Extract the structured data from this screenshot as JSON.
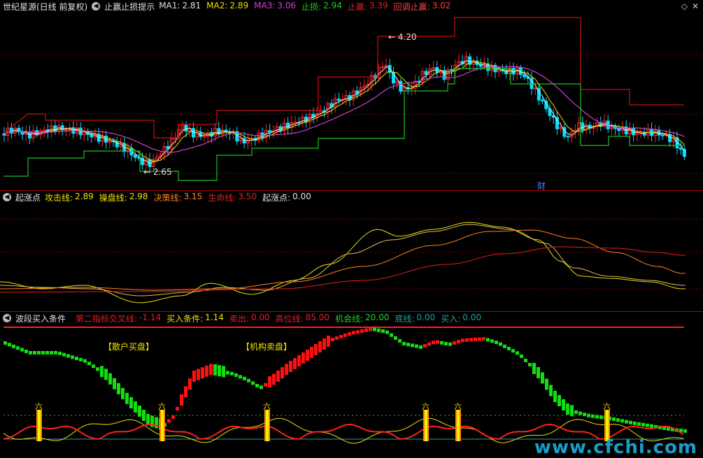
{
  "main_pane": {
    "title": "世纪星源(日线 前复权)",
    "indicator_name": "止赢止损提示",
    "fields": [
      {
        "label": "MA1:",
        "value": "2.81",
        "color": "#e0e0e0"
      },
      {
        "label": "MA2:",
        "value": "2.89",
        "color": "#f0e000"
      },
      {
        "label": "MA3:",
        "value": "3.06",
        "color": "#d040d0"
      },
      {
        "label": "止损:",
        "value": "2.94",
        "color": "#20d020"
      },
      {
        "label": "止赢:",
        "value": "3.39",
        "color": "#e02020"
      },
      {
        "label": "回调止赢:",
        "value": "3.02",
        "color": "#ff4040"
      }
    ],
    "high_label": "4.20",
    "low_label": "2.65",
    "event_marker": "财"
  },
  "pane2": {
    "indicator_name": "起涨点",
    "fields": [
      {
        "label": "攻击线:",
        "value": "2.89",
        "color": "#f0e000"
      },
      {
        "label": "操盘线:",
        "value": "2.98",
        "color": "#f0e000"
      },
      {
        "label": "决策线:",
        "value": "3.15",
        "color": "#ff8020"
      },
      {
        "label": "生命线:",
        "value": "3.50",
        "color": "#e02020"
      },
      {
        "label": "起涨点:",
        "value": "0.00",
        "color": "#e0e0e0"
      }
    ]
  },
  "pane3": {
    "indicator_name": "波段买入条件",
    "fields": [
      {
        "label": "第二指标交叉线:",
        "value": "-1.14",
        "color": "#e02020"
      },
      {
        "label": "买入条件:",
        "value": "1.14",
        "color": "#f0e000"
      },
      {
        "label": "卖出:",
        "value": "0.00",
        "color": "#e02020"
      },
      {
        "label": "高位线:",
        "value": "85.00",
        "color": "#e02020"
      },
      {
        "label": "机会线:",
        "value": "20.00",
        "color": "#20d020"
      },
      {
        "label": "底线:",
        "value": "0.00",
        "color": "#20a0a0"
      },
      {
        "label": "买入:",
        "value": "0.00",
        "color": "#20a0a0"
      }
    ],
    "annotation_left": "【散户买盘】",
    "annotation_right": "【机构卖盘】",
    "signal_mark": "六"
  },
  "watermark": "www.cfchi.com",
  "colors": {
    "up": "#ff2020",
    "down": "#00e0ff",
    "grid": "#7a0000",
    "bg": "#000000"
  }
}
